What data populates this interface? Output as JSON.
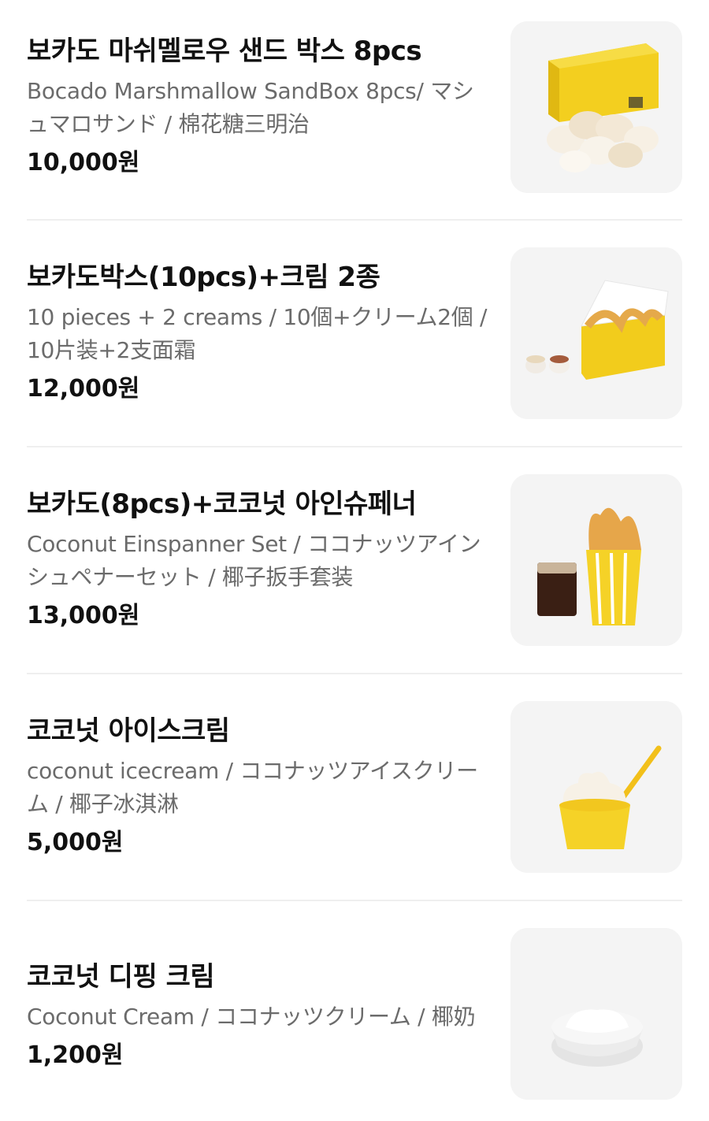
{
  "currency_suffix": "원",
  "items": [
    {
      "name": "보카도 마쉬멜로우 샌드 박스 8pcs",
      "description": "Bocado Marshmallow SandBox 8pcs/ マシュマロサンド / 棉花糖三明治",
      "price": "10,000원",
      "image": "marshmallow-box-photo"
    },
    {
      "name": "보카도박스(10pcs)+크림 2종",
      "description": "10 pieces + 2 creams / 10個+クリーム2個 / 10片装+2支面霜",
      "price": "12,000원",
      "image": "bocado-box-with-creams-photo"
    },
    {
      "name": "보카도(8pcs)+코코넛 아인슈페너",
      "description": "Coconut Einspanner Set / ココナッツアインシュペナーセット / 椰子扳手套装",
      "price": "13,000원",
      "image": "einspanner-set-photo"
    },
    {
      "name": "코코넛 아이스크림",
      "description": "coconut icecream / ココナッツアイスクリーム / 椰子冰淇淋",
      "price": "5,000원",
      "image": "icecream-cup-photo"
    },
    {
      "name": "코코넛 디핑 크림",
      "description": "Coconut Cream / ココナッツクリーム / 椰奶",
      "price": "1,200원",
      "image": "dipping-cream-photo"
    }
  ]
}
